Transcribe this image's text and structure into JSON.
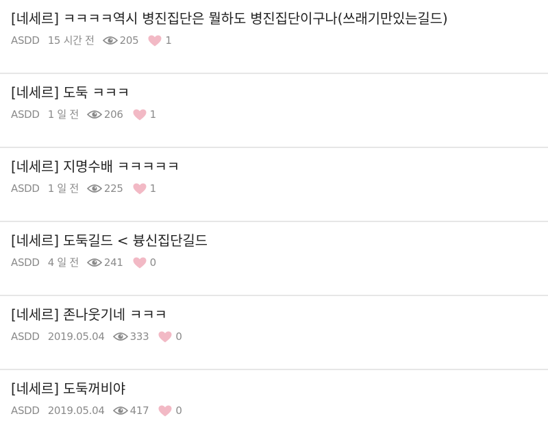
{
  "colors": {
    "title": "#222222",
    "meta": "#8a8a8a",
    "heart": "#f2b9c5",
    "divider": "#e6e6e6"
  },
  "icons": {
    "views": "eye-icon",
    "likes": "heart-icon"
  },
  "posts": [
    {
      "title": "[네세르] ㅋㅋㅋㅋ역시 병진집단은 뭘하도 병진집단이구나(쓰래기만있는길드)",
      "author": "ASDD",
      "time": "15 시간 전",
      "views": "205",
      "likes": "1"
    },
    {
      "title": "[네세르] 도둑 ㅋㅋㅋ",
      "author": "ASDD",
      "time": "1 일 전",
      "views": "206",
      "likes": "1"
    },
    {
      "title": "[네세르] 지명수배 ㅋㅋㅋㅋㅋ",
      "author": "ASDD",
      "time": "1 일 전",
      "views": "225",
      "likes": "1"
    },
    {
      "title": "[네세르] 도둑길드 < 븅신집단길드",
      "author": "ASDD",
      "time": "4 일 전",
      "views": "241",
      "likes": "0"
    },
    {
      "title": "[네세르] 존나웃기네 ㅋㅋㅋ",
      "author": "ASDD",
      "time": "2019.05.04",
      "views": "333",
      "likes": "0"
    },
    {
      "title": "[네세르] 도둑꺼비야",
      "author": "ASDD",
      "time": "2019.05.04",
      "views": "417",
      "likes": "0"
    }
  ]
}
